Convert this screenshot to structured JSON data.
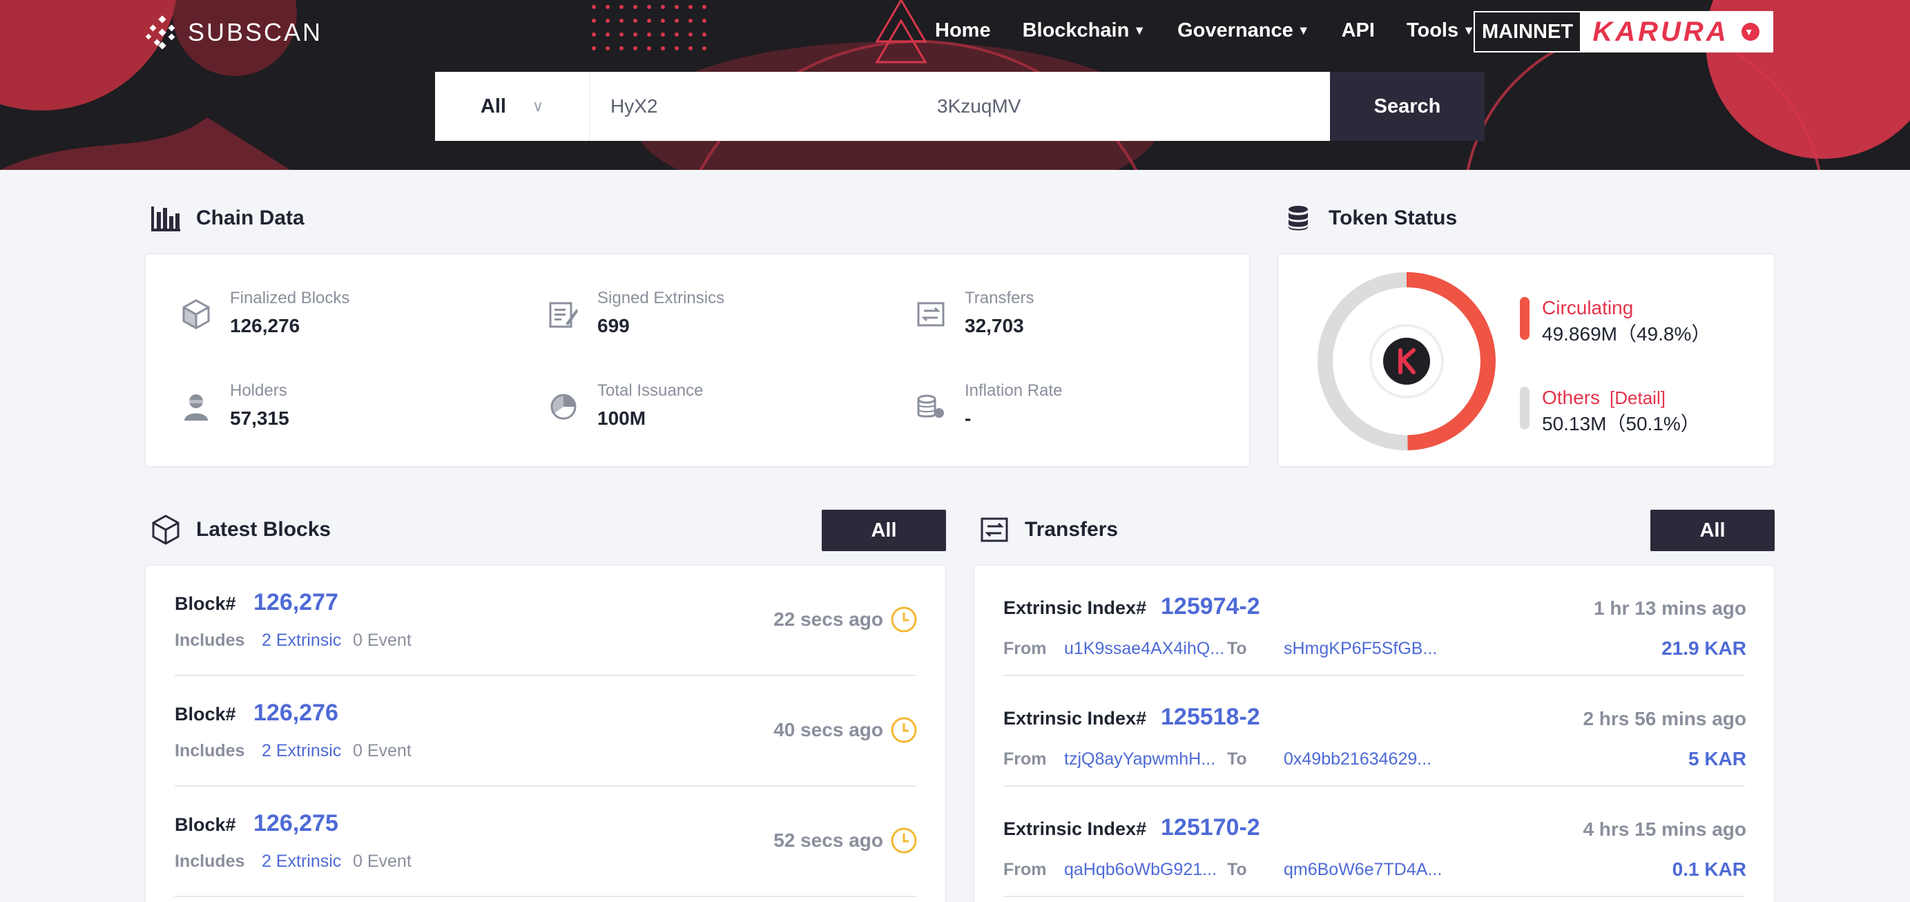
{
  "header": {
    "logo": "SUBSCAN",
    "nav": [
      {
        "label": "Home",
        "dropdown": false
      },
      {
        "label": "Blockchain",
        "dropdown": true
      },
      {
        "label": "Governance",
        "dropdown": true
      },
      {
        "label": "API",
        "dropdown": false
      },
      {
        "label": "Tools",
        "dropdown": true
      }
    ],
    "network_label": "MAINNET",
    "network_brand": "KARURA",
    "colors": {
      "bg": "#1e1d21",
      "accent": "#e5334b"
    }
  },
  "search": {
    "filter": "All",
    "value": "HyX2                                                    3KzuqMV",
    "button": "Search"
  },
  "chain_data": {
    "title": "Chain Data",
    "stats": [
      {
        "label": "Finalized Blocks",
        "value": "126,276",
        "icon": "cube-icon"
      },
      {
        "label": "Signed Extrinsics",
        "value": "699",
        "icon": "signed-doc-icon"
      },
      {
        "label": "Transfers",
        "value": "32,703",
        "icon": "transfer-icon"
      },
      {
        "label": "Holders",
        "value": "57,315",
        "icon": "user-icon"
      },
      {
        "label": "Total Issuance",
        "value": "100M",
        "icon": "pie-icon"
      },
      {
        "label": "Inflation Rate",
        "value": "-",
        "icon": "coins-icon"
      }
    ]
  },
  "token_status": {
    "title": "Token Status",
    "circulating_label": "Circulating",
    "circulating_value": "49.869M（49.8%）",
    "circulating_fraction": 0.498,
    "others_label": "Others",
    "others_detail": "[Detail]",
    "others_value": "50.13M（50.1%）",
    "colors": {
      "circulating": "#ef5444",
      "others": "#dcdcdc"
    }
  },
  "latest_blocks": {
    "title": "Latest Blocks",
    "all_button": "All",
    "block_label": "Block#",
    "includes_label": "Includes",
    "rows": [
      {
        "number": "126,277",
        "extrinsic": "2 Extrinsic",
        "event": "0 Event",
        "ago": "22 secs ago"
      },
      {
        "number": "126,276",
        "extrinsic": "2 Extrinsic",
        "event": "0 Event",
        "ago": "40 secs ago"
      },
      {
        "number": "126,275",
        "extrinsic": "2 Extrinsic",
        "event": "0 Event",
        "ago": "52 secs ago"
      }
    ]
  },
  "transfers": {
    "title": "Transfers",
    "all_button": "All",
    "index_label": "Extrinsic Index#",
    "from_label": "From",
    "to_label": "To",
    "rows": [
      {
        "index": "125974-2",
        "ago": "1 hr 13 mins ago",
        "from": "u1K9ssae4AX4ihQ...",
        "to": "sHmgKP6F5SfGB...",
        "amount": "21.9 KAR"
      },
      {
        "index": "125518-2",
        "ago": "2 hrs 56 mins ago",
        "from": "tzjQ8ayYapwmhH...",
        "to": "0x49bb21634629...",
        "amount": "5 KAR"
      },
      {
        "index": "125170-2",
        "ago": "4 hrs 15 mins ago",
        "from": "qaHqb6oWbG921...",
        "to": "qm6BoW6e7TD4A...",
        "amount": "0.1 KAR"
      }
    ]
  }
}
